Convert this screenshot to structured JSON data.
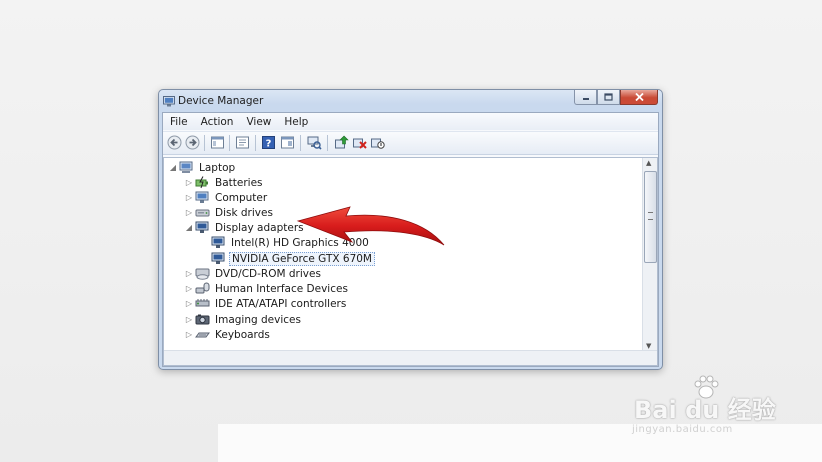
{
  "window": {
    "title": "Device Manager",
    "icon": "device-manager-icon",
    "controls": [
      "minimize-icon",
      "maximize-icon",
      "close-icon"
    ]
  },
  "menubar": {
    "items": [
      {
        "label": "File"
      },
      {
        "label": "Action"
      },
      {
        "label": "View"
      },
      {
        "label": "Help"
      }
    ]
  },
  "toolbar": {
    "buttons": [
      "back-arrow-icon",
      "forward-arrow-icon",
      "properties-sheet-icon",
      "show-hide-console-tree-icon",
      "help-icon",
      "action-pane-icon",
      "scan-hardware-icon",
      "update-driver-icon",
      "uninstall-icon",
      "disable-device-icon"
    ]
  },
  "tree": {
    "root": {
      "label": "Laptop",
      "icon": "computer-icon",
      "expanded": true
    },
    "items": [
      {
        "label": "Batteries",
        "icon": "battery-icon",
        "expanded": false
      },
      {
        "label": "Computer",
        "icon": "monitor-icon",
        "expanded": false
      },
      {
        "label": "Disk drives",
        "icon": "disk-drive-icon",
        "expanded": false
      },
      {
        "label": "Display adapters",
        "icon": "display-adapter-icon",
        "expanded": true
      },
      {
        "label": "Intel(R) HD Graphics 4000",
        "icon": "display-adapter-icon",
        "child": true
      },
      {
        "label": "NVIDIA GeForce GTX 670M",
        "icon": "display-adapter-icon",
        "child": true,
        "selected": true
      },
      {
        "label": "DVD/CD-ROM drives",
        "icon": "optical-drive-icon",
        "expanded": false
      },
      {
        "label": "Human Interface Devices",
        "icon": "hid-icon",
        "expanded": false
      },
      {
        "label": "IDE ATA/ATAPI controllers",
        "icon": "ide-controller-icon",
        "expanded": false
      },
      {
        "label": "Imaging devices",
        "icon": "camera-icon",
        "expanded": false
      },
      {
        "label": "Keyboards",
        "icon": "keyboard-icon",
        "expanded": false
      }
    ]
  },
  "annotation": {
    "icon": "red-arrow-icon",
    "color": "#d81c1c"
  },
  "watermark": {
    "brand": "Bai du 经验",
    "url": "jingyan.baidu.com"
  }
}
